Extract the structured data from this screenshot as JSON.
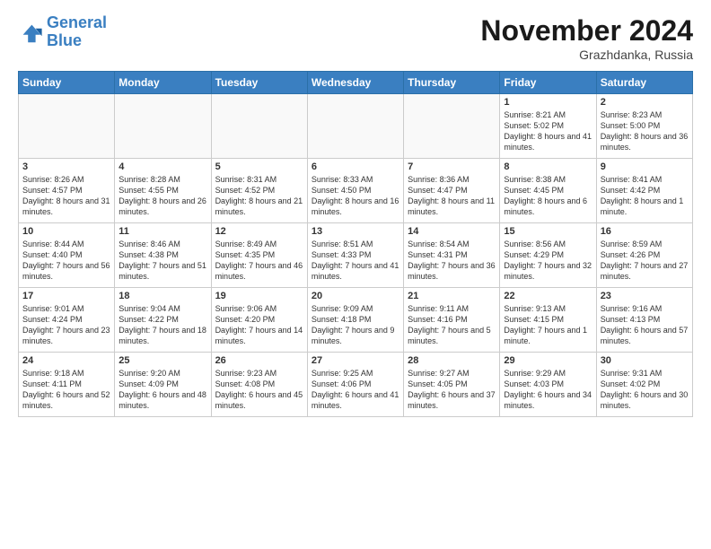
{
  "header": {
    "logo_line1": "General",
    "logo_line2": "Blue",
    "title": "November 2024",
    "subtitle": "Grazhdanka, Russia"
  },
  "days_of_week": [
    "Sunday",
    "Monday",
    "Tuesday",
    "Wednesday",
    "Thursday",
    "Friday",
    "Saturday"
  ],
  "weeks": [
    [
      {
        "day": "",
        "info": ""
      },
      {
        "day": "",
        "info": ""
      },
      {
        "day": "",
        "info": ""
      },
      {
        "day": "",
        "info": ""
      },
      {
        "day": "",
        "info": ""
      },
      {
        "day": "1",
        "info": "Sunrise: 8:21 AM\nSunset: 5:02 PM\nDaylight: 8 hours and 41 minutes."
      },
      {
        "day": "2",
        "info": "Sunrise: 8:23 AM\nSunset: 5:00 PM\nDaylight: 8 hours and 36 minutes."
      }
    ],
    [
      {
        "day": "3",
        "info": "Sunrise: 8:26 AM\nSunset: 4:57 PM\nDaylight: 8 hours and 31 minutes."
      },
      {
        "day": "4",
        "info": "Sunrise: 8:28 AM\nSunset: 4:55 PM\nDaylight: 8 hours and 26 minutes."
      },
      {
        "day": "5",
        "info": "Sunrise: 8:31 AM\nSunset: 4:52 PM\nDaylight: 8 hours and 21 minutes."
      },
      {
        "day": "6",
        "info": "Sunrise: 8:33 AM\nSunset: 4:50 PM\nDaylight: 8 hours and 16 minutes."
      },
      {
        "day": "7",
        "info": "Sunrise: 8:36 AM\nSunset: 4:47 PM\nDaylight: 8 hours and 11 minutes."
      },
      {
        "day": "8",
        "info": "Sunrise: 8:38 AM\nSunset: 4:45 PM\nDaylight: 8 hours and 6 minutes."
      },
      {
        "day": "9",
        "info": "Sunrise: 8:41 AM\nSunset: 4:42 PM\nDaylight: 8 hours and 1 minute."
      }
    ],
    [
      {
        "day": "10",
        "info": "Sunrise: 8:44 AM\nSunset: 4:40 PM\nDaylight: 7 hours and 56 minutes."
      },
      {
        "day": "11",
        "info": "Sunrise: 8:46 AM\nSunset: 4:38 PM\nDaylight: 7 hours and 51 minutes."
      },
      {
        "day": "12",
        "info": "Sunrise: 8:49 AM\nSunset: 4:35 PM\nDaylight: 7 hours and 46 minutes."
      },
      {
        "day": "13",
        "info": "Sunrise: 8:51 AM\nSunset: 4:33 PM\nDaylight: 7 hours and 41 minutes."
      },
      {
        "day": "14",
        "info": "Sunrise: 8:54 AM\nSunset: 4:31 PM\nDaylight: 7 hours and 36 minutes."
      },
      {
        "day": "15",
        "info": "Sunrise: 8:56 AM\nSunset: 4:29 PM\nDaylight: 7 hours and 32 minutes."
      },
      {
        "day": "16",
        "info": "Sunrise: 8:59 AM\nSunset: 4:26 PM\nDaylight: 7 hours and 27 minutes."
      }
    ],
    [
      {
        "day": "17",
        "info": "Sunrise: 9:01 AM\nSunset: 4:24 PM\nDaylight: 7 hours and 23 minutes."
      },
      {
        "day": "18",
        "info": "Sunrise: 9:04 AM\nSunset: 4:22 PM\nDaylight: 7 hours and 18 minutes."
      },
      {
        "day": "19",
        "info": "Sunrise: 9:06 AM\nSunset: 4:20 PM\nDaylight: 7 hours and 14 minutes."
      },
      {
        "day": "20",
        "info": "Sunrise: 9:09 AM\nSunset: 4:18 PM\nDaylight: 7 hours and 9 minutes."
      },
      {
        "day": "21",
        "info": "Sunrise: 9:11 AM\nSunset: 4:16 PM\nDaylight: 7 hours and 5 minutes."
      },
      {
        "day": "22",
        "info": "Sunrise: 9:13 AM\nSunset: 4:15 PM\nDaylight: 7 hours and 1 minute."
      },
      {
        "day": "23",
        "info": "Sunrise: 9:16 AM\nSunset: 4:13 PM\nDaylight: 6 hours and 57 minutes."
      }
    ],
    [
      {
        "day": "24",
        "info": "Sunrise: 9:18 AM\nSunset: 4:11 PM\nDaylight: 6 hours and 52 minutes."
      },
      {
        "day": "25",
        "info": "Sunrise: 9:20 AM\nSunset: 4:09 PM\nDaylight: 6 hours and 48 minutes."
      },
      {
        "day": "26",
        "info": "Sunrise: 9:23 AM\nSunset: 4:08 PM\nDaylight: 6 hours and 45 minutes."
      },
      {
        "day": "27",
        "info": "Sunrise: 9:25 AM\nSunset: 4:06 PM\nDaylight: 6 hours and 41 minutes."
      },
      {
        "day": "28",
        "info": "Sunrise: 9:27 AM\nSunset: 4:05 PM\nDaylight: 6 hours and 37 minutes."
      },
      {
        "day": "29",
        "info": "Sunrise: 9:29 AM\nSunset: 4:03 PM\nDaylight: 6 hours and 34 minutes."
      },
      {
        "day": "30",
        "info": "Sunrise: 9:31 AM\nSunset: 4:02 PM\nDaylight: 6 hours and 30 minutes."
      }
    ]
  ]
}
